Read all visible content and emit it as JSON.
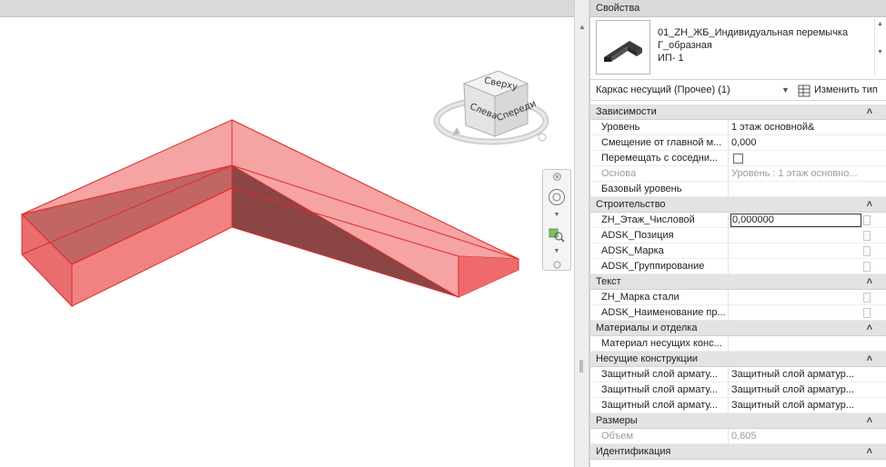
{
  "viewport": {
    "viewcube": {
      "top_label": "Сверху",
      "left_label": "Слева",
      "front_label": "Спереди"
    },
    "navbar": {
      "close_icon": "close-icon",
      "wheel_icon": "steering-wheel-icon",
      "zoom_icon": "zoom-region-icon"
    },
    "colors": {
      "beam_fill": "#f06a6a",
      "beam_edge": "#e22b2b",
      "beam_dark": "#7a3a3a"
    }
  },
  "properties": {
    "title": "Свойства",
    "type": {
      "name_line1": "01_ZH_ЖБ_Индивидуальная перемычка",
      "name_line2": "Г_образная",
      "name_line3": "ИП- 1"
    },
    "selector": {
      "value": "Каркас несущий (Прочее) (1)",
      "edit_type_label": "Изменить тип"
    },
    "categories": [
      {
        "name": "Зависимости",
        "rows": [
          {
            "key": "Уровень",
            "value": "1 этаж основной&"
          },
          {
            "key": "Смещение от главной м...",
            "value": "0,000"
          },
          {
            "key": "Перемещать с соседни...",
            "value": "",
            "checkbox": true
          },
          {
            "key": "Основа",
            "value": "Уровень : 1 этаж основно...",
            "dim": true
          },
          {
            "key": "Базовый уровень",
            "value": ""
          }
        ]
      },
      {
        "name": "Строительство",
        "rows": [
          {
            "key": "ZH_Этаж_Числовой",
            "value": "0,000000",
            "editing": true,
            "assoc": true
          },
          {
            "key": "ADSK_Позиция",
            "value": "",
            "assoc": true
          },
          {
            "key": "ADSK_Марка",
            "value": "",
            "assoc": true
          },
          {
            "key": "ADSK_Группирование",
            "value": "",
            "assoc": true
          }
        ]
      },
      {
        "name": "Текст",
        "rows": [
          {
            "key": "ZH_Марка стали",
            "value": "",
            "assoc": true
          },
          {
            "key": "ADSK_Наименование пр...",
            "value": "",
            "assoc": true
          }
        ]
      },
      {
        "name": "Материалы и отделка",
        "rows": [
          {
            "key": "Материал несущих конс...",
            "value": ""
          }
        ]
      },
      {
        "name": "Несущие конструкции",
        "rows": [
          {
            "key": "Защитный слой армату...",
            "value": "Защитный слой арматур..."
          },
          {
            "key": "Защитный слой армату...",
            "value": "Защитный слой арматур..."
          },
          {
            "key": "Защитный слой армату...",
            "value": "Защитный слой арматур..."
          }
        ]
      },
      {
        "name": "Размеры",
        "rows": [
          {
            "key": "Объем",
            "value": "0,605",
            "dim": true
          }
        ]
      },
      {
        "name": "Идентификация",
        "rows": []
      }
    ]
  }
}
